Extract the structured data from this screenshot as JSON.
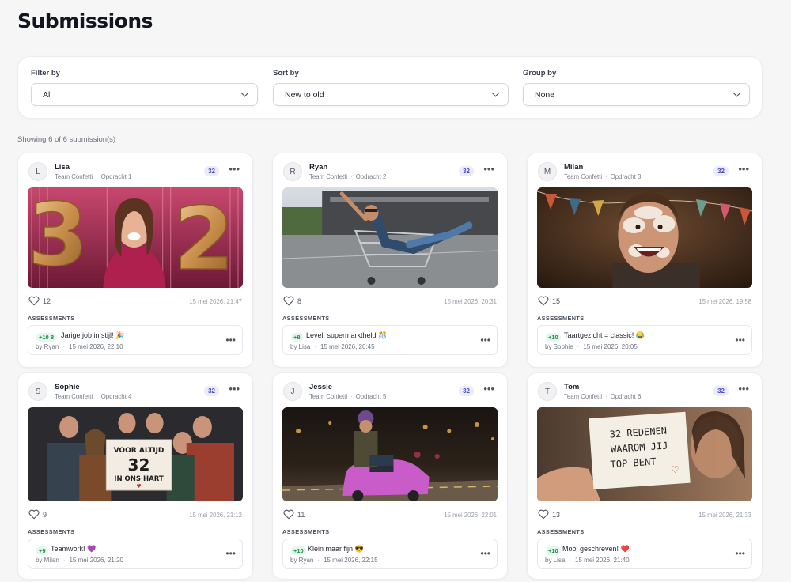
{
  "page": {
    "title": "Submissions"
  },
  "filters": {
    "filter_by": {
      "label": "Filter by",
      "value": "All"
    },
    "sort_by": {
      "label": "Sort by",
      "value": "New to old"
    },
    "group_by": {
      "label": "Group by",
      "value": "None"
    }
  },
  "showing_text": "Showing 6 of 6 submission(s)",
  "assessments_label": "ASSESSMENTS",
  "cards": [
    {
      "initial": "L",
      "name": "Lisa",
      "team": "Team Confetti",
      "assignment": "Opdracht 1",
      "count": "32",
      "likes": "12",
      "date": "15 mei 2026, 21:47",
      "assessment": {
        "points": "+10",
        "points_extra": "8",
        "text": "Jarige job in stijl! 🎉",
        "by": "by Ryan",
        "date": "15 mei 2026, 22:10"
      }
    },
    {
      "initial": "R",
      "name": "Ryan",
      "team": "Team Confetti",
      "assignment": "Opdracht 2",
      "count": "32",
      "likes": "8",
      "date": "15 mei 2026, 20:31",
      "assessment": {
        "points": "+8",
        "points_extra": "",
        "text": "Level: supermarktheld 🎊",
        "by": "by Lisa",
        "date": "15 mei 2026, 20:45"
      }
    },
    {
      "initial": "M",
      "name": "Milan",
      "team": "Team Confetti",
      "assignment": "Opdracht 3",
      "count": "32",
      "likes": "15",
      "date": "15 mei 2026, 19:58",
      "assessment": {
        "points": "+10",
        "points_extra": "",
        "text": "Taartgezicht = classic! 😂",
        "by": "by Sophie",
        "date": "15 mei 2026, 20:05"
      }
    },
    {
      "initial": "S",
      "name": "Sophie",
      "team": "Team Confetti",
      "assignment": "Opdracht 4",
      "count": "32",
      "likes": "9",
      "date": "15 mei 2026, 21:12",
      "assessment": {
        "points": "+9",
        "points_extra": "",
        "text": "Teamwork! 💜",
        "by": "by Milan",
        "date": "15 mei 2026, 21:20"
      }
    },
    {
      "initial": "J",
      "name": "Jessie",
      "team": "Team Confetti",
      "assignment": "Opdracht 5",
      "count": "32",
      "likes": "11",
      "date": "15 mei 2026, 22:01",
      "assessment": {
        "points": "+10",
        "points_extra": "",
        "text": "Klein maar fijn 😎",
        "by": "by Ryan",
        "date": "15 mei 2026, 22:15"
      }
    },
    {
      "initial": "T",
      "name": "Tom",
      "team": "Team Confetti",
      "assignment": "Opdracht 6",
      "count": "32",
      "likes": "13",
      "date": "15 mei 2026, 21:33",
      "assessment": {
        "points": "+10",
        "points_extra": "",
        "text": "Mooi geschreven! ❤️",
        "by": "by Lisa",
        "date": "15 mei 2026, 21:40"
      }
    }
  ],
  "photos": {
    "balloon_digits": "32",
    "sign_lines": [
      "VOOR ALTIJD",
      "32",
      "IN ONS HART"
    ],
    "note_lines": [
      "32 REDENEN",
      "WAAROM JIJ",
      "TOP BENT"
    ]
  },
  "colors": {
    "accent": "#4a4fc9",
    "accent_bg": "#ebebfa",
    "points_green": "#1f8a4c",
    "points_bg": "#e6f6ec"
  }
}
